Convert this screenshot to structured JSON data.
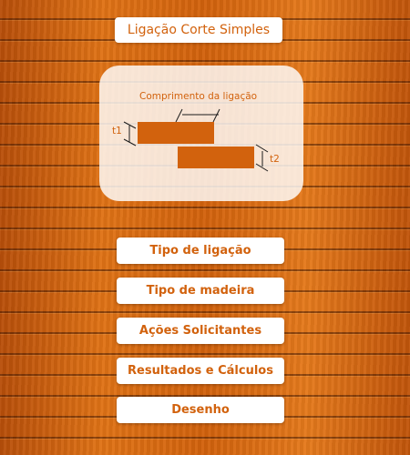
{
  "header": {
    "title": "Ligação Corte Simples"
  },
  "diagram": {
    "length_label": "Comprimento da ligação",
    "t1_label": "t1",
    "t2_label": "t2",
    "plate_color": "#d2620d"
  },
  "menu": {
    "items": [
      {
        "label": "Tipo de ligação"
      },
      {
        "label": "Tipo de madeira"
      },
      {
        "label": "Ações Solicitantes"
      },
      {
        "label": "Resultados e Cálculos"
      },
      {
        "label": "Desenho"
      }
    ]
  },
  "colors": {
    "accent": "#d2620d",
    "button_bg": "#ffffff"
  }
}
